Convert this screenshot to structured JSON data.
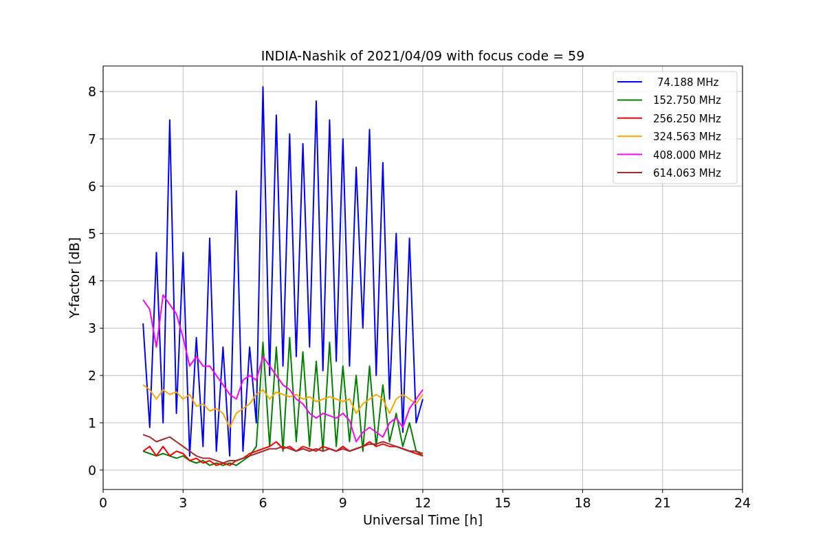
{
  "figure": {
    "chart_data": {
      "type": "line",
      "title": "INDIA-Nashik of 2021/04/09 with focus code = 59",
      "xlabel": "Universal Time [h]",
      "ylabel": "Y-factor [dB]",
      "x": [
        1.5,
        1.75,
        2,
        2.25,
        2.5,
        2.75,
        3,
        3.25,
        3.5,
        3.75,
        4,
        4.25,
        4.5,
        4.75,
        5,
        5.25,
        5.5,
        5.75,
        6,
        6.25,
        6.5,
        6.75,
        7,
        7.25,
        7.5,
        7.75,
        8,
        8.25,
        8.5,
        8.75,
        9,
        9.25,
        9.5,
        9.75,
        10,
        10.25,
        10.5,
        10.75,
        11,
        11.25,
        11.5,
        11.75,
        12
      ],
      "series": [
        {
          "name": "74.188 MHz",
          "color": "#0000ff",
          "values": [
            3.1,
            0.9,
            4.6,
            1.0,
            7.4,
            1.2,
            4.6,
            0.3,
            2.8,
            0.5,
            4.9,
            0.4,
            2.6,
            0.3,
            5.9,
            0.4,
            2.6,
            1.0,
            8.1,
            2.0,
            7.5,
            2.2,
            7.1,
            2.4,
            6.9,
            2.6,
            7.8,
            2.1,
            7.4,
            2.3,
            7.0,
            2.2,
            6.4,
            3.0,
            7.2,
            2.0,
            6.5,
            1.5,
            5.0,
            0.8,
            4.9,
            1.0,
            1.5
          ]
        },
        {
          "name": "152.750 MHz",
          "color": "#008000",
          "values": [
            0.4,
            0.35,
            0.3,
            0.35,
            0.3,
            0.25,
            0.3,
            0.2,
            0.15,
            0.2,
            0.1,
            0.15,
            0.1,
            0.15,
            0.1,
            0.2,
            0.3,
            0.5,
            2.7,
            0.5,
            2.6,
            0.4,
            2.8,
            0.6,
            2.5,
            0.5,
            2.3,
            0.4,
            2.7,
            0.5,
            2.2,
            0.6,
            2.0,
            0.4,
            2.2,
            0.5,
            1.8,
            0.6,
            1.2,
            0.5,
            1.0,
            0.4,
            0.3
          ]
        },
        {
          "name": "256.250 MHz",
          "color": "#ff0000",
          "values": [
            0.4,
            0.5,
            0.3,
            0.5,
            0.3,
            0.4,
            0.35,
            0.2,
            0.25,
            0.15,
            0.2,
            0.1,
            0.15,
            0.1,
            0.2,
            0.25,
            0.35,
            0.4,
            0.45,
            0.5,
            0.6,
            0.45,
            0.5,
            0.4,
            0.5,
            0.45,
            0.4,
            0.5,
            0.45,
            0.4,
            0.5,
            0.4,
            0.45,
            0.5,
            0.6,
            0.5,
            0.55,
            0.5,
            0.5,
            0.45,
            0.4,
            0.35,
            0.3
          ]
        },
        {
          "name": "324.563 MHz",
          "color": "#ffa500",
          "values": [
            1.8,
            1.7,
            1.5,
            1.7,
            1.6,
            1.65,
            1.5,
            1.6,
            1.35,
            1.4,
            1.25,
            1.3,
            1.2,
            0.9,
            1.2,
            1.3,
            1.4,
            1.6,
            1.7,
            1.5,
            1.65,
            1.6,
            1.55,
            1.6,
            1.5,
            1.55,
            1.45,
            1.5,
            1.55,
            1.5,
            1.45,
            1.5,
            1.2,
            1.4,
            1.5,
            1.6,
            1.5,
            1.2,
            1.5,
            1.6,
            1.5,
            1.4,
            1.6
          ]
        },
        {
          "name": "408.000 MHz",
          "color": "#ff00ff",
          "values": [
            3.6,
            3.4,
            2.6,
            3.7,
            3.5,
            3.3,
            2.8,
            2.2,
            2.4,
            2.2,
            2.2,
            2.0,
            1.8,
            1.6,
            1.5,
            1.9,
            2.0,
            1.9,
            2.4,
            2.2,
            2.0,
            1.8,
            1.7,
            1.5,
            1.4,
            1.2,
            1.1,
            1.2,
            1.15,
            1.1,
            1.2,
            1.05,
            0.6,
            0.8,
            0.9,
            0.8,
            0.7,
            1.0,
            1.1,
            0.9,
            1.3,
            1.5,
            1.7
          ]
        },
        {
          "name": "614.063 MHz",
          "color": "#a52a2a",
          "values": [
            0.75,
            0.7,
            0.6,
            0.65,
            0.7,
            0.6,
            0.5,
            0.4,
            0.3,
            0.25,
            0.25,
            0.2,
            0.15,
            0.2,
            0.2,
            0.25,
            0.3,
            0.35,
            0.4,
            0.45,
            0.45,
            0.5,
            0.45,
            0.4,
            0.45,
            0.4,
            0.45,
            0.4,
            0.45,
            0.4,
            0.45,
            0.4,
            0.45,
            0.5,
            0.55,
            0.55,
            0.6,
            0.55,
            0.5,
            0.45,
            0.4,
            0.4,
            0.35
          ]
        }
      ],
      "xlim": [
        0,
        24
      ],
      "ylim": [
        -0.41,
        8.54
      ],
      "xticks": [
        0,
        3,
        6,
        9,
        12,
        15,
        18,
        21,
        24
      ],
      "yticks": [
        0,
        1,
        2,
        3,
        4,
        5,
        6,
        7,
        8
      ],
      "grid": true,
      "legend": true
    }
  }
}
